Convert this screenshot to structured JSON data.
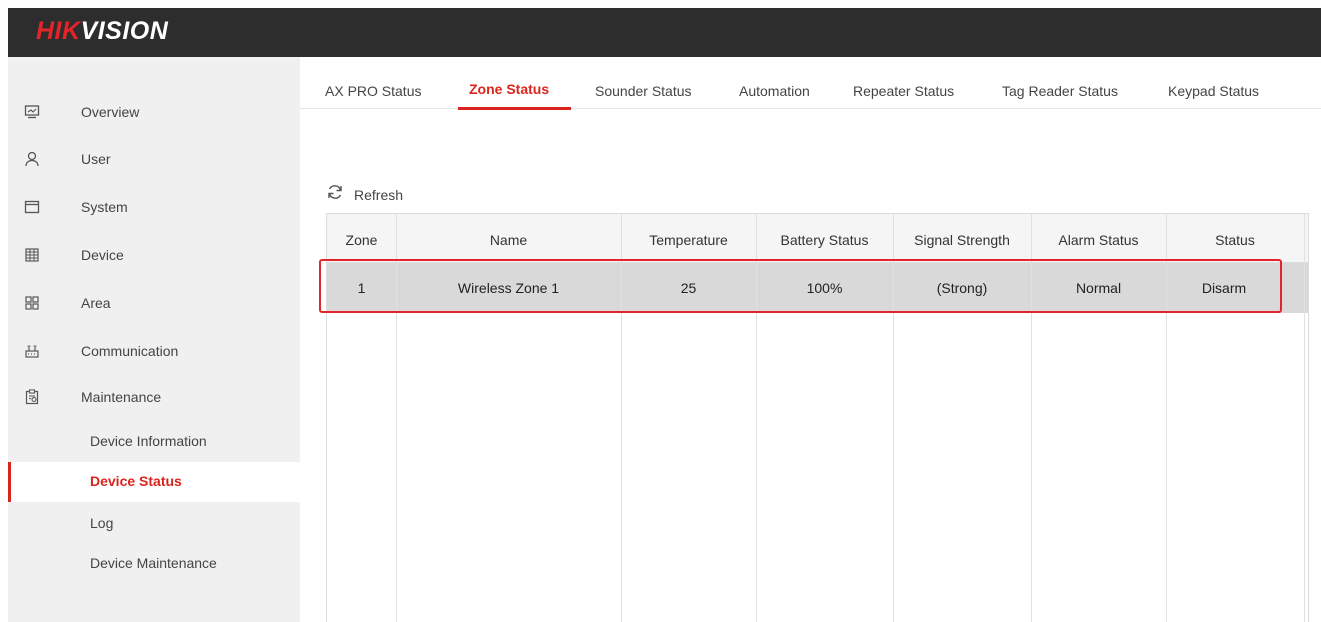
{
  "app": {
    "logo_hik": "HIK",
    "logo_vision": "VISION"
  },
  "sidebar": {
    "items": [
      {
        "label": "Overview",
        "icon": "monitor-icon"
      },
      {
        "label": "User",
        "icon": "user-icon"
      },
      {
        "label": "System",
        "icon": "system-window-icon"
      },
      {
        "label": "Device",
        "icon": "device-grid-icon"
      },
      {
        "label": "Area",
        "icon": "area-grid-icon"
      },
      {
        "label": "Communication",
        "icon": "communication-icon"
      },
      {
        "label": "Maintenance",
        "icon": "maintenance-clipboard-icon"
      }
    ],
    "subitems": [
      {
        "label": "Device Information"
      },
      {
        "label": "Device Status"
      },
      {
        "label": "Log"
      },
      {
        "label": "Device Maintenance"
      }
    ]
  },
  "tabs": [
    {
      "label": "AX PRO Status"
    },
    {
      "label": "Zone Status"
    },
    {
      "label": "Sounder Status"
    },
    {
      "label": "Automation"
    },
    {
      "label": "Repeater Status"
    },
    {
      "label": "Tag Reader Status"
    },
    {
      "label": "Keypad Status"
    }
  ],
  "toolbar": {
    "refresh_label": "Refresh"
  },
  "table": {
    "headers": [
      "Zone",
      "Name",
      "Temperature",
      "Battery Status",
      "Signal Strength",
      "Alarm Status",
      "Status"
    ],
    "rows": [
      [
        "1",
        "Wireless Zone 1",
        "25",
        "100%",
        "(Strong)",
        "Normal",
        "Disarm"
      ]
    ]
  },
  "colors": {
    "accent": "#d9251d",
    "topbar": "#2d2d2d",
    "sidebar": "#f0f0f0",
    "highlight_box": "#e3242b"
  }
}
